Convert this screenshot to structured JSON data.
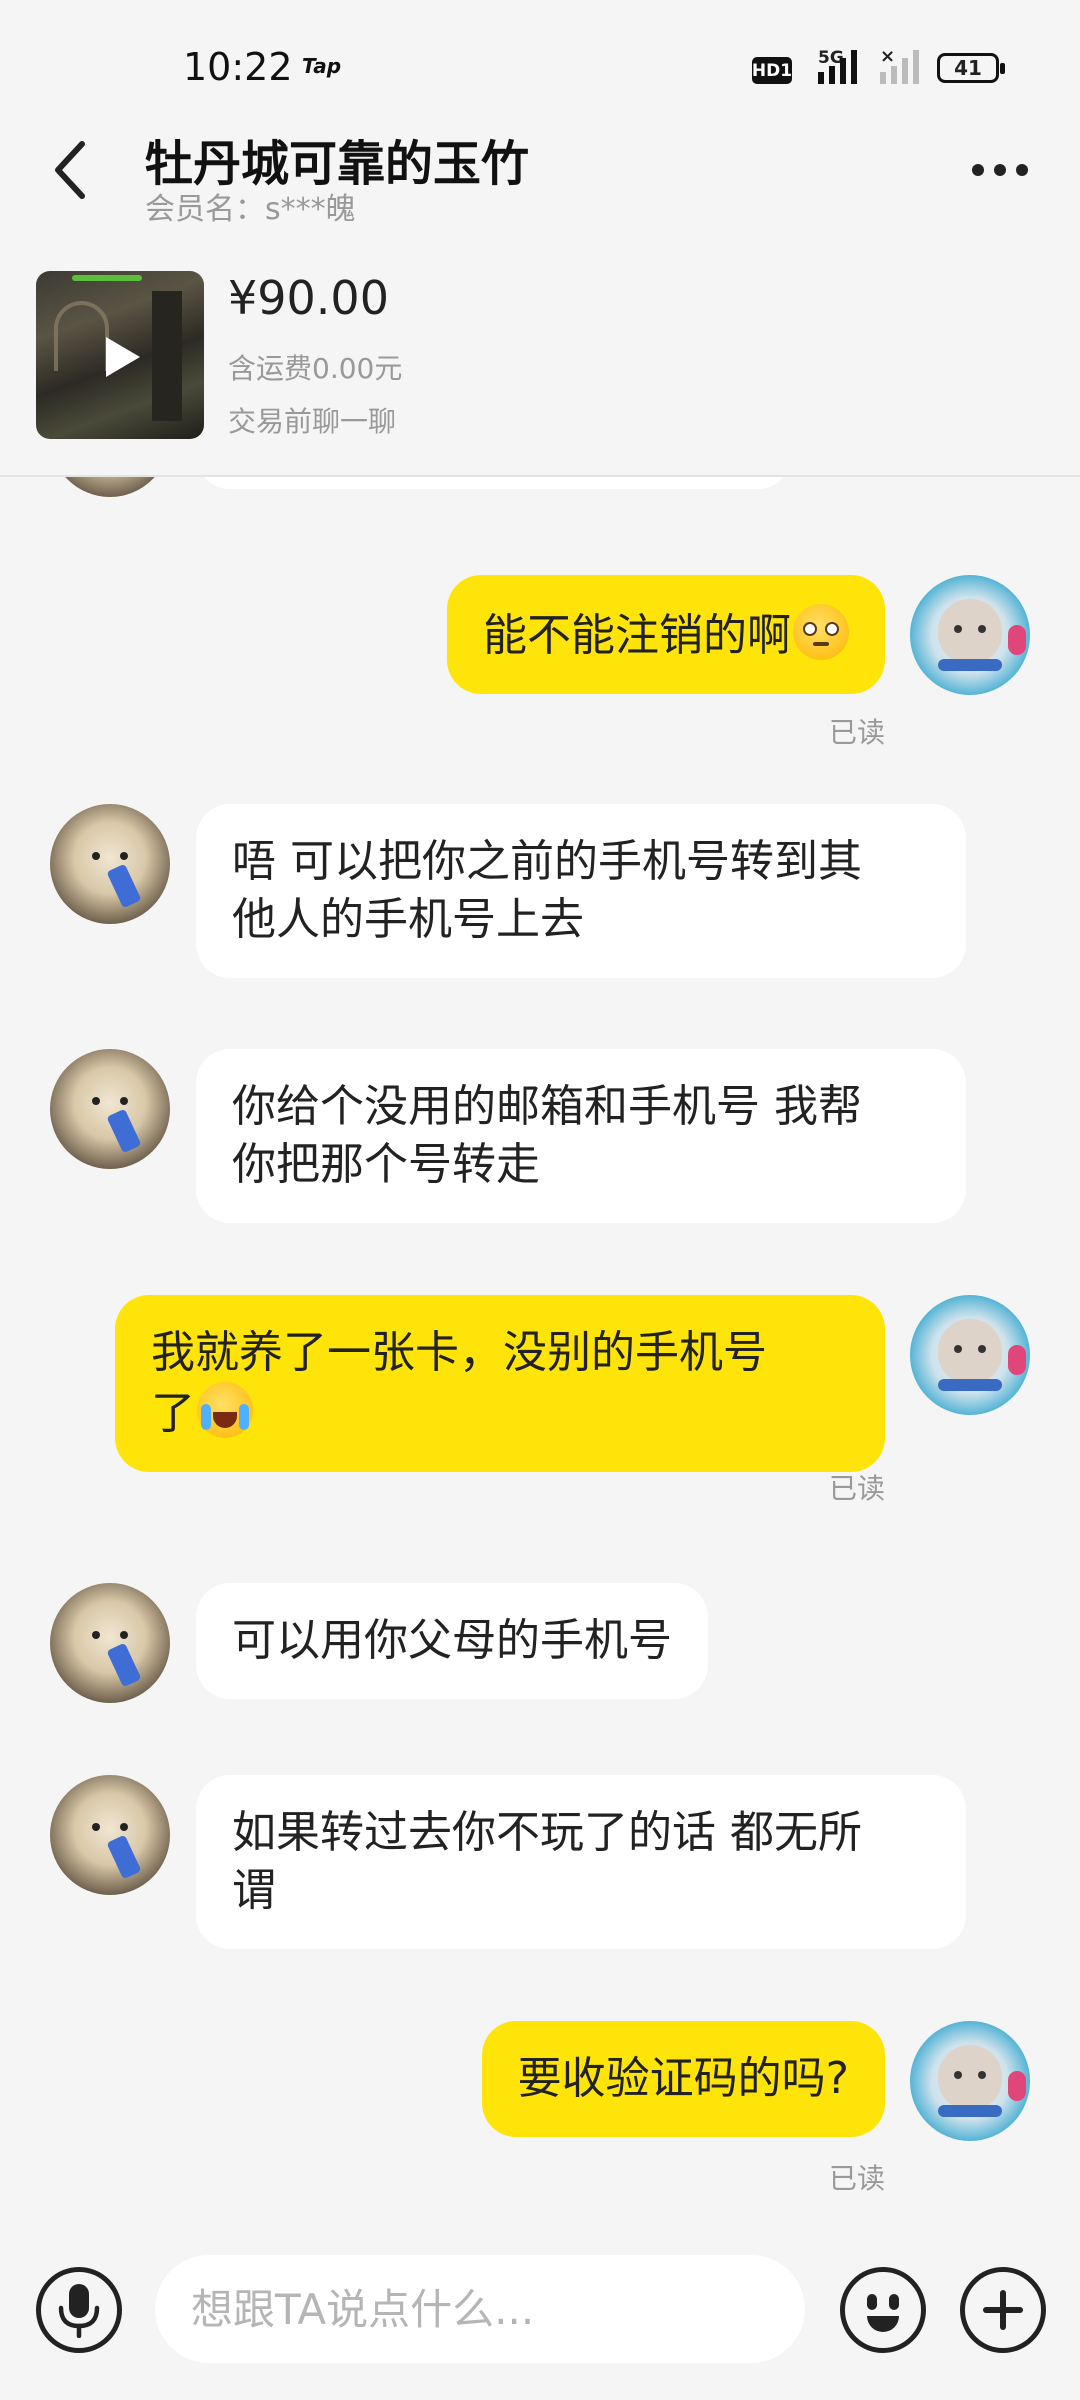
{
  "status_bar": {
    "time": "10:22",
    "tap_label": "Tap",
    "hd_label": "HD1",
    "network_label": "5G",
    "battery_level": "41"
  },
  "header": {
    "title": "牡丹城可靠的玉竹",
    "member_label": "会员名：s***魄"
  },
  "product": {
    "price": "¥90.00",
    "shipping": "含运费0.00元",
    "hint": "交易前聊一聊"
  },
  "messages": [
    {
      "side": "out",
      "text": "能不能注销的啊",
      "emoji": "awkward",
      "read": "已读"
    },
    {
      "side": "in",
      "lines": [
        "唔 可以把你之前的手机号转到其",
        "他人的手机号上去"
      ]
    },
    {
      "side": "in",
      "lines": [
        "你给个没用的邮箱和手机号 我帮",
        "你把那个号转走"
      ]
    },
    {
      "side": "out",
      "lines": [
        "我就养了一张卡，没别的手机号",
        "了"
      ],
      "emoji": "laugh-cry",
      "read": "已读"
    },
    {
      "side": "in",
      "lines": [
        "可以用你父母的手机号"
      ]
    },
    {
      "side": "in",
      "lines": [
        "如果转过去你不玩了的话 都无所",
        "谓"
      ]
    },
    {
      "side": "out",
      "text": "要收验证码的吗?",
      "read": "已读"
    }
  ],
  "input": {
    "placeholder": "想跟TA说点什么..."
  },
  "colors": {
    "outgoing_bubble": "#ffe40a",
    "incoming_bubble": "#ffffff",
    "background": "#f5f5f5"
  }
}
